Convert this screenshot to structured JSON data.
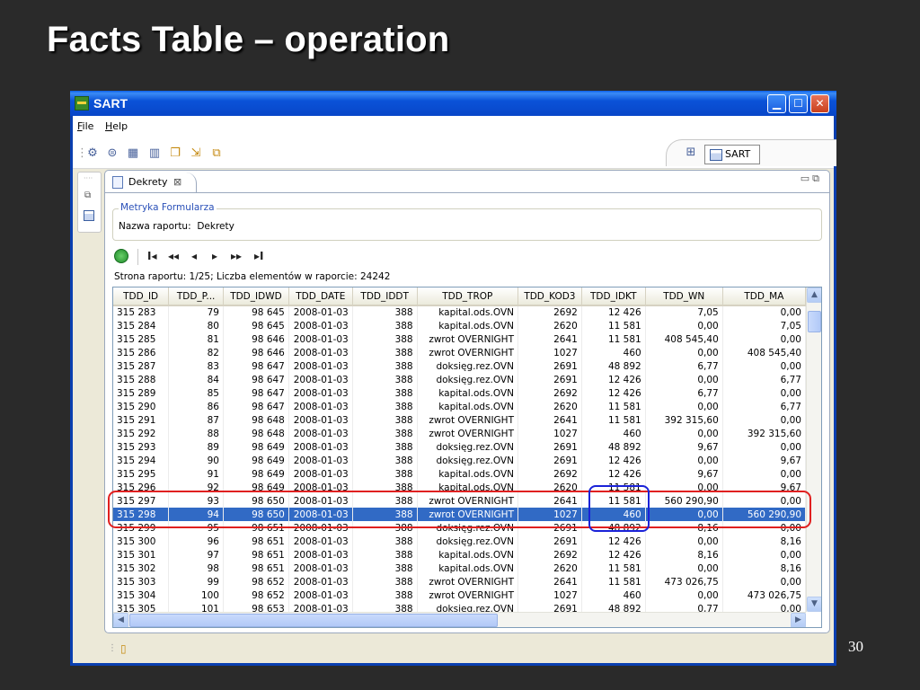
{
  "slide": {
    "title": "Facts Table – operation",
    "page_number": "30"
  },
  "window": {
    "title": "SART"
  },
  "menu": [
    {
      "label": "File",
      "mnemonic": "F",
      "rest": "ile"
    },
    {
      "label": "Help",
      "mnemonic": "H",
      "rest": "elp"
    }
  ],
  "toolbar": {
    "icons": [
      "settings-icon",
      "export-icon",
      "data-icon",
      "columns-icon",
      "copy-icon",
      "import-icon",
      "bundle-icon"
    ],
    "perspective_label": "SART"
  },
  "view": {
    "tab_label": "Dekrety",
    "group_title": "Metryka Formularza",
    "report_name_label": "Nazwa raportu:",
    "report_name_value": "Dekrety",
    "nav_buttons": [
      "I◂",
      "◂◂",
      "◂",
      "▸",
      "▸▸",
      "▸I"
    ],
    "status_line": "Strona raportu: 1/25; Liczba elementów w raporcie: 24242"
  },
  "table": {
    "columns": [
      "TDD_ID",
      "TDD_P...",
      "TDD_IDWD",
      "TDD_DATE",
      "TDD_IDDT",
      "TDD_TROP",
      "TDD_KOD3",
      "TDD_IDKT",
      "TDD_WN",
      "TDD_MA"
    ],
    "selected_row": 15,
    "rows": [
      [
        "315 283",
        "79",
        "98 645",
        "2008-01-03",
        "388",
        "kapital.ods.OVN",
        "2692",
        "12 426",
        "7,05",
        "0,00"
      ],
      [
        "315 284",
        "80",
        "98 645",
        "2008-01-03",
        "388",
        "kapital.ods.OVN",
        "2620",
        "11 581",
        "0,00",
        "7,05"
      ],
      [
        "315 285",
        "81",
        "98 646",
        "2008-01-03",
        "388",
        "zwrot OVERNIGHT",
        "2641",
        "11 581",
        "408 545,40",
        "0,00"
      ],
      [
        "315 286",
        "82",
        "98 646",
        "2008-01-03",
        "388",
        "zwrot OVERNIGHT",
        "1027",
        "460",
        "0,00",
        "408 545,40"
      ],
      [
        "315 287",
        "83",
        "98 647",
        "2008-01-03",
        "388",
        "doksięg.rez.OVN",
        "2691",
        "48 892",
        "6,77",
        "0,00"
      ],
      [
        "315 288",
        "84",
        "98 647",
        "2008-01-03",
        "388",
        "doksięg.rez.OVN",
        "2691",
        "12 426",
        "0,00",
        "6,77"
      ],
      [
        "315 289",
        "85",
        "98 647",
        "2008-01-03",
        "388",
        "kapital.ods.OVN",
        "2692",
        "12 426",
        "6,77",
        "0,00"
      ],
      [
        "315 290",
        "86",
        "98 647",
        "2008-01-03",
        "388",
        "kapital.ods.OVN",
        "2620",
        "11 581",
        "0,00",
        "6,77"
      ],
      [
        "315 291",
        "87",
        "98 648",
        "2008-01-03",
        "388",
        "zwrot OVERNIGHT",
        "2641",
        "11 581",
        "392 315,60",
        "0,00"
      ],
      [
        "315 292",
        "88",
        "98 648",
        "2008-01-03",
        "388",
        "zwrot OVERNIGHT",
        "1027",
        "460",
        "0,00",
        "392 315,60"
      ],
      [
        "315 293",
        "89",
        "98 649",
        "2008-01-03",
        "388",
        "doksięg.rez.OVN",
        "2691",
        "48 892",
        "9,67",
        "0,00"
      ],
      [
        "315 294",
        "90",
        "98 649",
        "2008-01-03",
        "388",
        "doksięg.rez.OVN",
        "2691",
        "12 426",
        "0,00",
        "9,67"
      ],
      [
        "315 295",
        "91",
        "98 649",
        "2008-01-03",
        "388",
        "kapital.ods.OVN",
        "2692",
        "12 426",
        "9,67",
        "0,00"
      ],
      [
        "315 296",
        "92",
        "98 649",
        "2008-01-03",
        "388",
        "kapital.ods.OVN",
        "2620",
        "11 581",
        "0,00",
        "9,67"
      ],
      [
        "315 297",
        "93",
        "98 650",
        "2008-01-03",
        "388",
        "zwrot OVERNIGHT",
        "2641",
        "11 581",
        "560 290,90",
        "0,00"
      ],
      [
        "315 298",
        "94",
        "98 650",
        "2008-01-03",
        "388",
        "zwrot OVERNIGHT",
        "1027",
        "460",
        "0,00",
        "560 290,90"
      ],
      [
        "315 299",
        "95",
        "98 651",
        "2008-01-03",
        "388",
        "doksięg.rez.OVN",
        "2691",
        "48 892",
        "8,16",
        "0,00"
      ],
      [
        "315 300",
        "96",
        "98 651",
        "2008-01-03",
        "388",
        "doksięg.rez.OVN",
        "2691",
        "12 426",
        "0,00",
        "8,16"
      ],
      [
        "315 301",
        "97",
        "98 651",
        "2008-01-03",
        "388",
        "kapital.ods.OVN",
        "2692",
        "12 426",
        "8,16",
        "0,00"
      ],
      [
        "315 302",
        "98",
        "98 651",
        "2008-01-03",
        "388",
        "kapital.ods.OVN",
        "2620",
        "11 581",
        "0,00",
        "8,16"
      ],
      [
        "315 303",
        "99",
        "98 652",
        "2008-01-03",
        "388",
        "zwrot OVERNIGHT",
        "2641",
        "11 581",
        "473 026,75",
        "0,00"
      ],
      [
        "315 304",
        "100",
        "98 652",
        "2008-01-03",
        "388",
        "zwrot OVERNIGHT",
        "1027",
        "460",
        "0,00",
        "473 026,75"
      ],
      [
        "315 305",
        "101",
        "98 653",
        "2008-01-03",
        "388",
        "doksięg.rez.OVN",
        "2691",
        "48 892",
        "0,77",
        "0,00"
      ]
    ]
  },
  "colors": {
    "selection": "#316ac5",
    "highlight_row": "#e02020",
    "highlight_cell": "#1a22d8"
  }
}
